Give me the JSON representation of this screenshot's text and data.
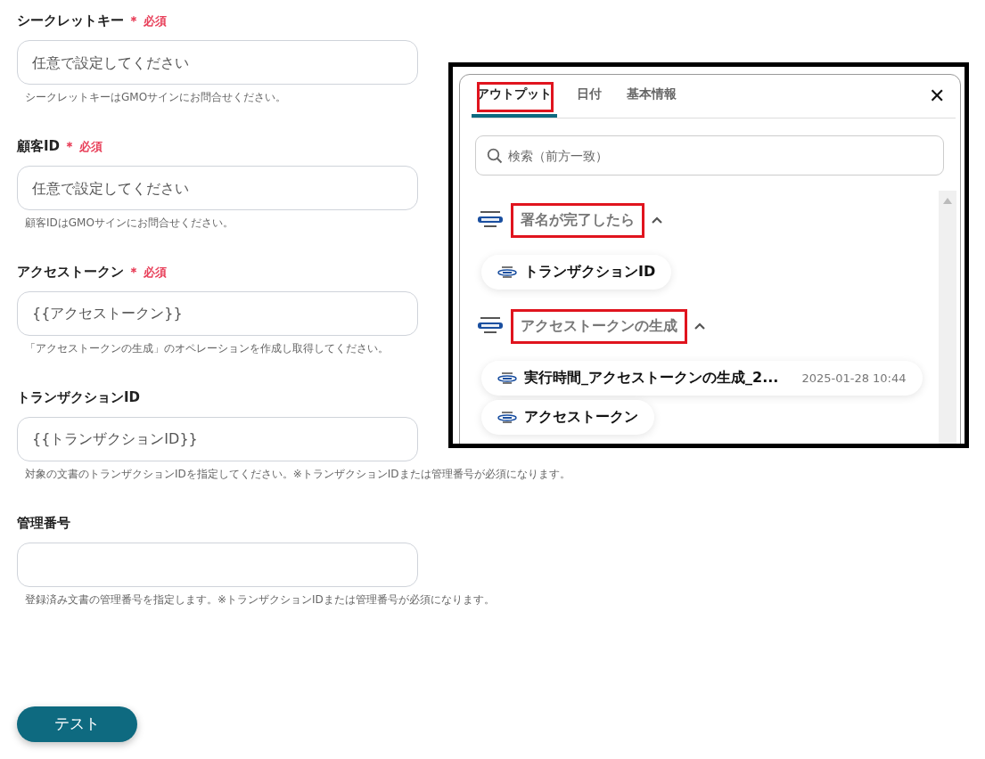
{
  "form": {
    "fields": [
      {
        "label": "シークレットキー",
        "required_mark": "＊",
        "required_text": "必須",
        "placeholder": "任意で設定してください",
        "help": "シークレットキーはGMOサインにお問合せください。"
      },
      {
        "label": "顧客ID",
        "required_mark": "＊",
        "required_text": "必須",
        "placeholder": "任意で設定してください",
        "help": "顧客IDはGMOサインにお問合せください。"
      },
      {
        "label": "アクセストークン",
        "required_mark": "＊",
        "required_text": "必須",
        "value": "{{アクセストークン}}",
        "help": "「アクセストークンの生成」のオペレーションを作成し取得してください。"
      },
      {
        "label": "トランザクションID",
        "value": "{{トランザクションID}}",
        "help": "対象の文書のトランザクションIDを指定してください。※トランザクションIDまたは管理番号が必須になります。"
      },
      {
        "label": "管理番号",
        "help": "登録済み文書の管理番号を指定します。※トランザクションIDまたは管理番号が必須になります。"
      }
    ],
    "test_button": "テスト"
  },
  "popup": {
    "tabs": [
      {
        "label": "アウトプット",
        "selected": true,
        "highlighted": true
      },
      {
        "label": "日付",
        "selected": false,
        "highlighted": false
      },
      {
        "label": "基本情報",
        "selected": false,
        "highlighted": false
      }
    ],
    "close": "✕",
    "search": {
      "placeholder": "検索（前方一致）"
    },
    "groups": [
      {
        "title": "署名が完了したら",
        "highlighted": true,
        "expanded": true,
        "items": [
          {
            "label": "トランザクションID"
          }
        ]
      },
      {
        "title": "アクセストークンの生成",
        "highlighted": true,
        "expanded": true,
        "items": [
          {
            "label": "実行時間_アクセストークンの生成_2...",
            "value": "2025-01-28 10:44"
          },
          {
            "label": "アクセストークン"
          }
        ]
      }
    ]
  }
}
